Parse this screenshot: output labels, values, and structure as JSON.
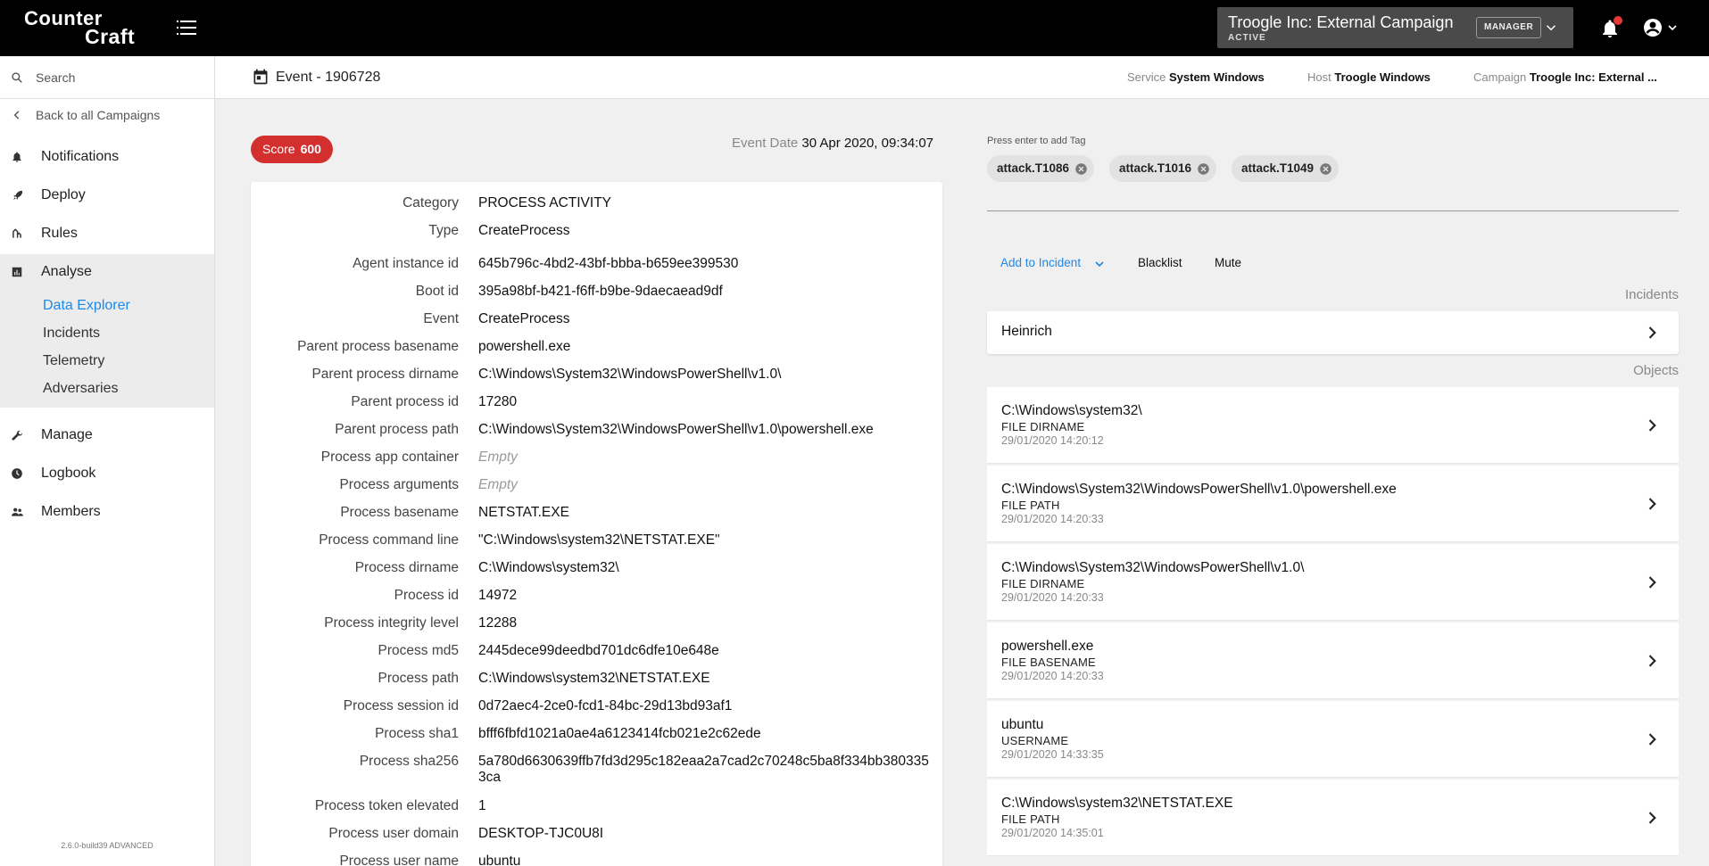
{
  "app": {
    "logo_line1": "Counter",
    "logo_line2": "Craft"
  },
  "campaign_selector": {
    "name": "Troogle Inc: External Campaign",
    "state": "ACTIVE",
    "role": "MANAGER"
  },
  "sidebar": {
    "search_placeholder": "Search",
    "back_label": "Back to all Campaigns",
    "items": [
      {
        "label": "Notifications",
        "icon": "bell-icon"
      },
      {
        "label": "Deploy",
        "icon": "rocket-icon"
      },
      {
        "label": "Rules",
        "icon": "rules-icon"
      },
      {
        "label": "Analyse",
        "icon": "chart-icon"
      },
      {
        "label": "Manage",
        "icon": "wrench-icon"
      },
      {
        "label": "Logbook",
        "icon": "clock-icon"
      },
      {
        "label": "Members",
        "icon": "people-icon"
      }
    ],
    "analyse_sub": [
      {
        "label": "Data Explorer",
        "active": true
      },
      {
        "label": "Incidents"
      },
      {
        "label": "Telemetry"
      },
      {
        "label": "Adversaries"
      }
    ],
    "version": "2.6.0-build39 ADVANCED"
  },
  "subheader": {
    "title": "Event - 1906728",
    "service_key": "Service",
    "service_value": "System Windows",
    "host_key": "Host",
    "host_value": "Troogle Windows",
    "campaign_key": "Campaign",
    "campaign_value": "Troogle Inc: External ..."
  },
  "event": {
    "score_label": "Score",
    "score_value": "600",
    "date_key": "Event Date",
    "date_value": "30 Apr 2020, 09:34:07",
    "fields": [
      {
        "k": "Category",
        "v": "PROCESS ACTIVITY"
      },
      {
        "k": "Type",
        "v": "CreateProcess"
      },
      {
        "k": "Agent instance id",
        "v": "645b796c-4bd2-43bf-bbba-b659ee399530"
      },
      {
        "k": "Boot id",
        "v": "395a98bf-b421-f6ff-b9be-9daecaead9df"
      },
      {
        "k": "Event",
        "v": "CreateProcess"
      },
      {
        "k": "Parent process basename",
        "v": "powershell.exe"
      },
      {
        "k": "Parent process dirname",
        "v": "C:\\Windows\\System32\\WindowsPowerShell\\v1.0\\"
      },
      {
        "k": "Parent process id",
        "v": "17280"
      },
      {
        "k": "Parent process path",
        "v": "C:\\Windows\\System32\\WindowsPowerShell\\v1.0\\powershell.exe"
      },
      {
        "k": "Process app container",
        "v": "Empty",
        "empty": true
      },
      {
        "k": "Process arguments",
        "v": "Empty",
        "empty": true
      },
      {
        "k": "Process basename",
        "v": "NETSTAT.EXE"
      },
      {
        "k": "Process command line",
        "v": "\"C:\\Windows\\system32\\NETSTAT.EXE\""
      },
      {
        "k": "Process dirname",
        "v": "C:\\Windows\\system32\\"
      },
      {
        "k": "Process id",
        "v": "14972"
      },
      {
        "k": "Process integrity level",
        "v": "12288"
      },
      {
        "k": "Process md5",
        "v": "2445dece99deedbd701dc6dfe10e648e"
      },
      {
        "k": "Process path",
        "v": "C:\\Windows\\system32\\NETSTAT.EXE"
      },
      {
        "k": "Process session id",
        "v": "0d72aec4-2ce0-fcd1-84bc-29d13bd93af1"
      },
      {
        "k": "Process sha1",
        "v": "bfff6fbfd1021a0ae4a6123414fcb021e2c62ede"
      },
      {
        "k": "Process sha256",
        "v": "5a780d6630639ffb7fd3d295c182eaa2a7cad2c70248c5ba8f334bb3803353ca"
      },
      {
        "k": "Process token elevated",
        "v": "1"
      },
      {
        "k": "Process user domain",
        "v": "DESKTOP-TJC0U8I"
      },
      {
        "k": "Process user name",
        "v": "ubuntu"
      }
    ]
  },
  "tags": {
    "hint": "Press enter to add Tag",
    "items": [
      "attack.T1086",
      "attack.T1016",
      "attack.T1049"
    ]
  },
  "actions": {
    "add_to_incident": "Add to Incident",
    "blacklist": "Blacklist",
    "mute": "Mute"
  },
  "incidents": {
    "label": "Incidents",
    "items": [
      "Heinrich"
    ]
  },
  "objects": {
    "label": "Objects",
    "items": [
      {
        "name": "C:\\Windows\\system32\\",
        "type": "FILE DIRNAME",
        "time": "29/01/2020 14:20:12"
      },
      {
        "name": "C:\\Windows\\System32\\WindowsPowerShell\\v1.0\\powershell.exe",
        "type": "FILE PATH",
        "time": "29/01/2020 14:20:33"
      },
      {
        "name": "C:\\Windows\\System32\\WindowsPowerShell\\v1.0\\",
        "type": "FILE DIRNAME",
        "time": "29/01/2020 14:20:33"
      },
      {
        "name": "powershell.exe",
        "type": "FILE BASENAME",
        "time": "29/01/2020 14:20:33"
      },
      {
        "name": "ubuntu",
        "type": "USERNAME",
        "time": "29/01/2020 14:33:35"
      },
      {
        "name": "C:\\Windows\\system32\\NETSTAT.EXE",
        "type": "FILE PATH",
        "time": "29/01/2020 14:35:01"
      }
    ]
  },
  "colors": {
    "accent": "#1e88e5",
    "score": "#d32f2f",
    "topbar": "#000000"
  }
}
